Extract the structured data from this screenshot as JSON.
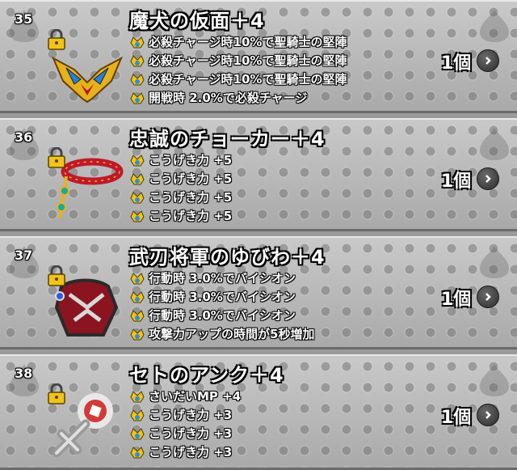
{
  "items": [
    {
      "number": "35",
      "name": "魔犬の仮面＋4",
      "effects": [
        "必殺チャージ時10%で聖騎士の堅陣",
        "必殺チャージ時10%で聖騎士の堅陣",
        "必殺チャージ時10%で聖騎士の堅陣",
        "開戦時 2.0%で必殺チャージ"
      ],
      "count": "1個",
      "icon": "mask-icon"
    },
    {
      "number": "36",
      "name": "忠誠のチョーカー＋4",
      "effects": [
        "こうげき力 +5",
        "こうげき力 +5",
        "こうげき力 +5",
        "こうげき力 +5"
      ],
      "count": "1個",
      "icon": "choker-icon"
    },
    {
      "number": "37",
      "name": "武刃将軍のゆびわ＋4",
      "effects": [
        "行動時 3.0%でバイシオン",
        "行動時 3.0%でバイシオン",
        "行動時 3.0%でバイシオン",
        "攻撃力アップの時間が5秒増加"
      ],
      "count": "1個",
      "icon": "ring-icon"
    },
    {
      "number": "38",
      "name": "セトのアンク＋4",
      "effects": [
        "さいだいMP +4",
        "こうげき力 +3",
        "こうげき力 +3",
        "こうげき力 +3"
      ],
      "count": "1個",
      "icon": "ankh-icon"
    }
  ],
  "colors": {
    "gold": "#f4c21a",
    "red": "#c0182a",
    "silver": "#cfcfcf"
  }
}
